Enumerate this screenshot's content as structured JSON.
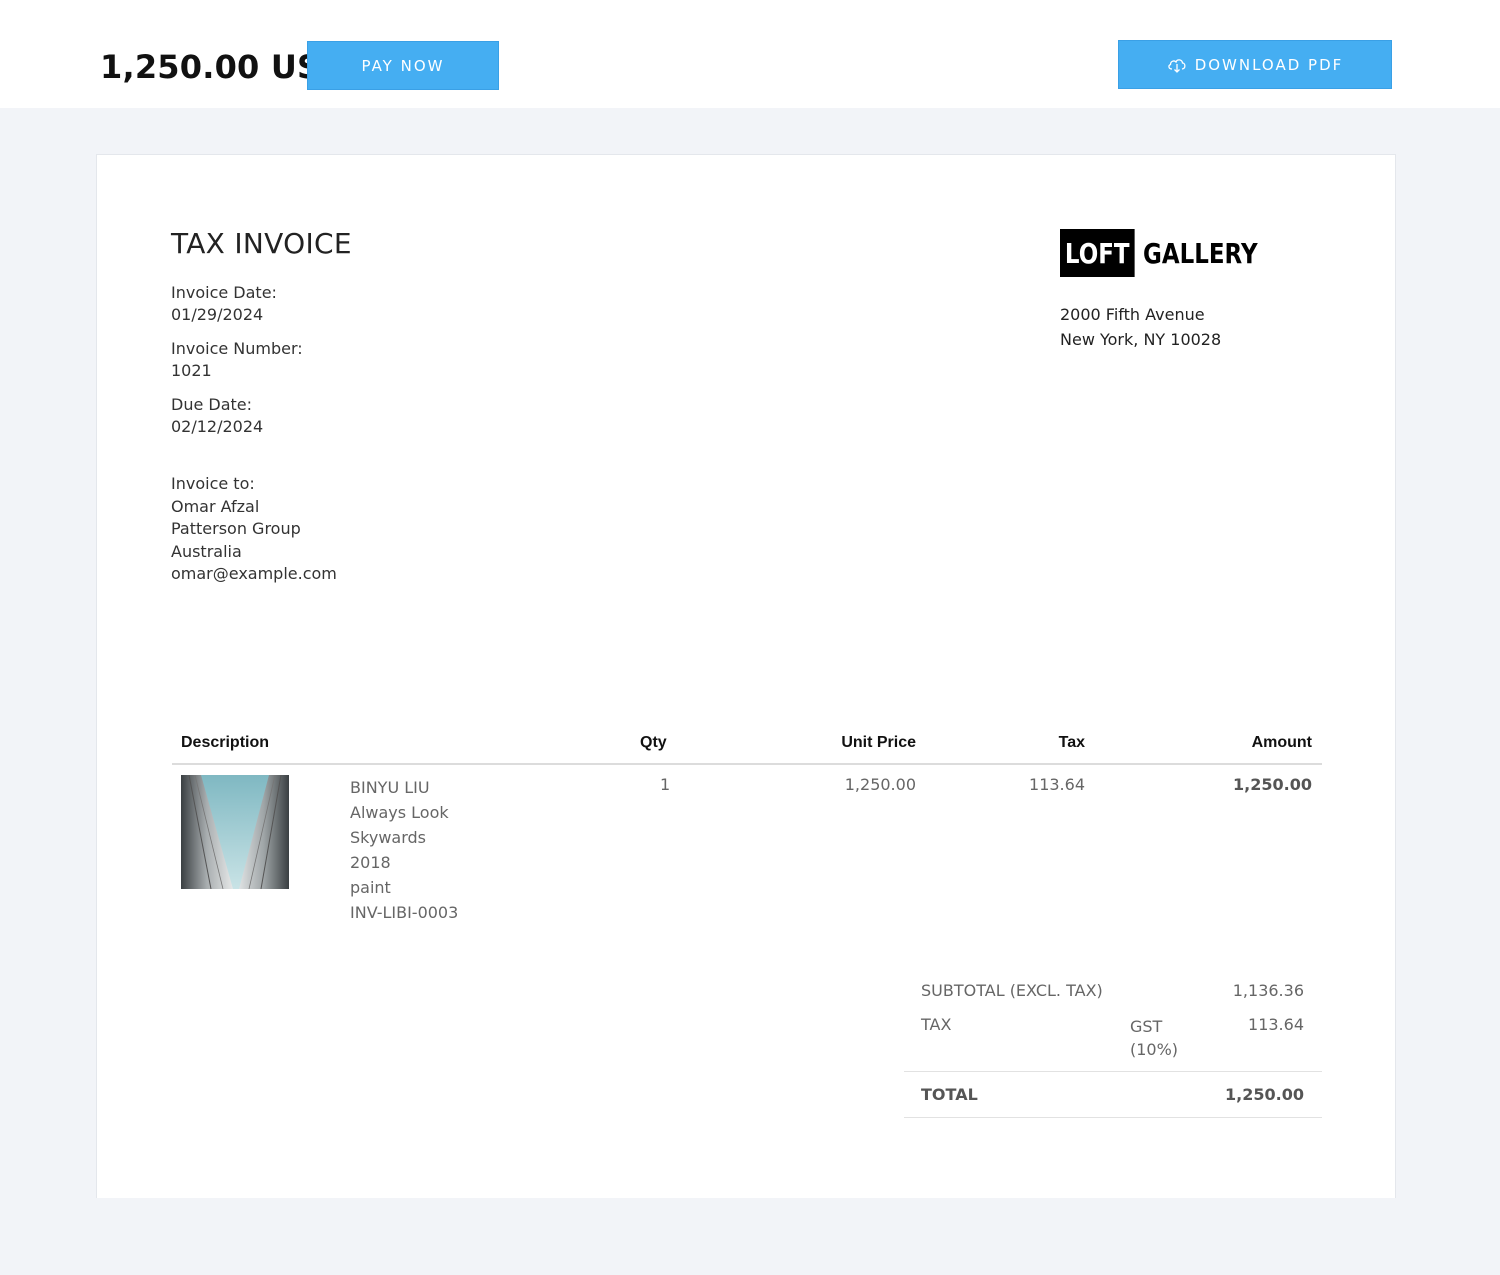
{
  "header": {
    "amount": "1,250.00 USD",
    "pay_label": "PAY NOW",
    "download_label": "DOWNLOAD PDF",
    "download_icon": "cloud-download-icon",
    "accent_color": "#45aef2"
  },
  "invoice": {
    "title": "TAX INVOICE",
    "date_label": "Invoice Date:",
    "date_value": "01/29/2024",
    "number_label": "Invoice Number:",
    "number_value": "1021",
    "due_label": "Due Date:",
    "due_value": "02/12/2024",
    "to_label": "Invoice to:",
    "to_name": "Omar Afzal",
    "to_company": "Patterson Group",
    "to_country": "Australia",
    "to_email": "omar@example.com"
  },
  "company": {
    "logo_part1": "LOFT",
    "logo_part2": "GALLERY",
    "address_line1": "2000 Fifth Avenue",
    "address_line2": "New York, NY 10028"
  },
  "table": {
    "headers": {
      "description": "Description",
      "qty": "Qty",
      "unit_price": "Unit Price",
      "tax": "Tax",
      "amount": "Amount"
    },
    "rows": [
      {
        "artist": "BINYU LIU",
        "title_line1": "Always Look",
        "title_line2": "Skywards",
        "year": "2018",
        "medium": "paint",
        "code": "INV-LIBI-0003",
        "qty": "1",
        "unit_price": "1,250.00",
        "tax": "113.64",
        "amount": "1,250.00"
      }
    ]
  },
  "summary": {
    "subtotal_label": "SUBTOTAL (EXCL. TAX)",
    "subtotal_value": "1,136.36",
    "tax_label": "TAX",
    "tax_type_line1": "GST",
    "tax_type_line2": "(10%)",
    "tax_value": "113.64",
    "total_label": "TOTAL",
    "total_value": "1,250.00"
  }
}
